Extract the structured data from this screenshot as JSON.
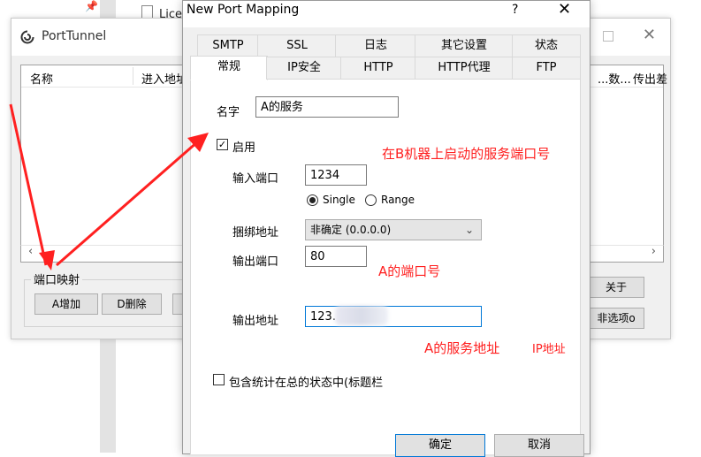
{
  "background_window": {
    "title": "PortTunnel",
    "columns": [
      "名称",
      "进入地址",
      "...数...",
      "传出差"
    ],
    "group_label": "端口映射",
    "buttons": {
      "add": "A增加",
      "delete": "D删除",
      "about": "关于",
      "options": "非选项o"
    }
  },
  "background": {
    "file_label": "Lice"
  },
  "dialog": {
    "title": "New Port Mapping",
    "help": "?",
    "close": "✕",
    "tabs_row1": [
      "SMTP",
      "SSL",
      "日志",
      "其它设置",
      "状态"
    ],
    "tabs_row2": [
      "常规",
      "IP安全",
      "HTTP",
      "HTTP代理",
      "FTP"
    ],
    "active_tab": "常规",
    "name_label": "名字",
    "name_value": "A的服务",
    "enable_label": "启用",
    "enable_checked": true,
    "in_port_label": "输入端口",
    "in_port_value": "1234",
    "radio_single": "Single",
    "radio_range": "Range",
    "bind_label": "捆绑地址",
    "bind_value": "非确定 (0.0.0.0)",
    "out_port_label": "输出端口",
    "out_port_value": "80",
    "out_addr_label": "输出地址",
    "out_addr_value": "123.",
    "stats_label": "包含统计在总的状态中(标题栏",
    "stats_checked": false,
    "ok": "确定",
    "cancel": "取消"
  },
  "annotations": {
    "service_port": "在B机器上启动的服务端口号",
    "port": "A的端口号",
    "address": "A的服务地址",
    "ip": "IP地址",
    "color": "#ff2020"
  }
}
